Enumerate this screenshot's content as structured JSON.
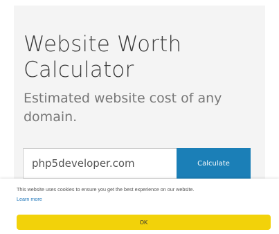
{
  "hero": {
    "title": "Website Worth Calculator",
    "subtitle": "Estimated website cost of any domain."
  },
  "form": {
    "domain_value": "php5developer.com",
    "calculate_label": "Calculate"
  },
  "cookie": {
    "message": "This website uses cookies to ensure you get the best experience on our website.",
    "learn_more_label": "Learn more",
    "ok_label": "OK"
  },
  "colors": {
    "button_blue": "#1b7fb7",
    "cookie_ok_yellow": "#f2d20a",
    "link_blue": "#1a73b8"
  }
}
